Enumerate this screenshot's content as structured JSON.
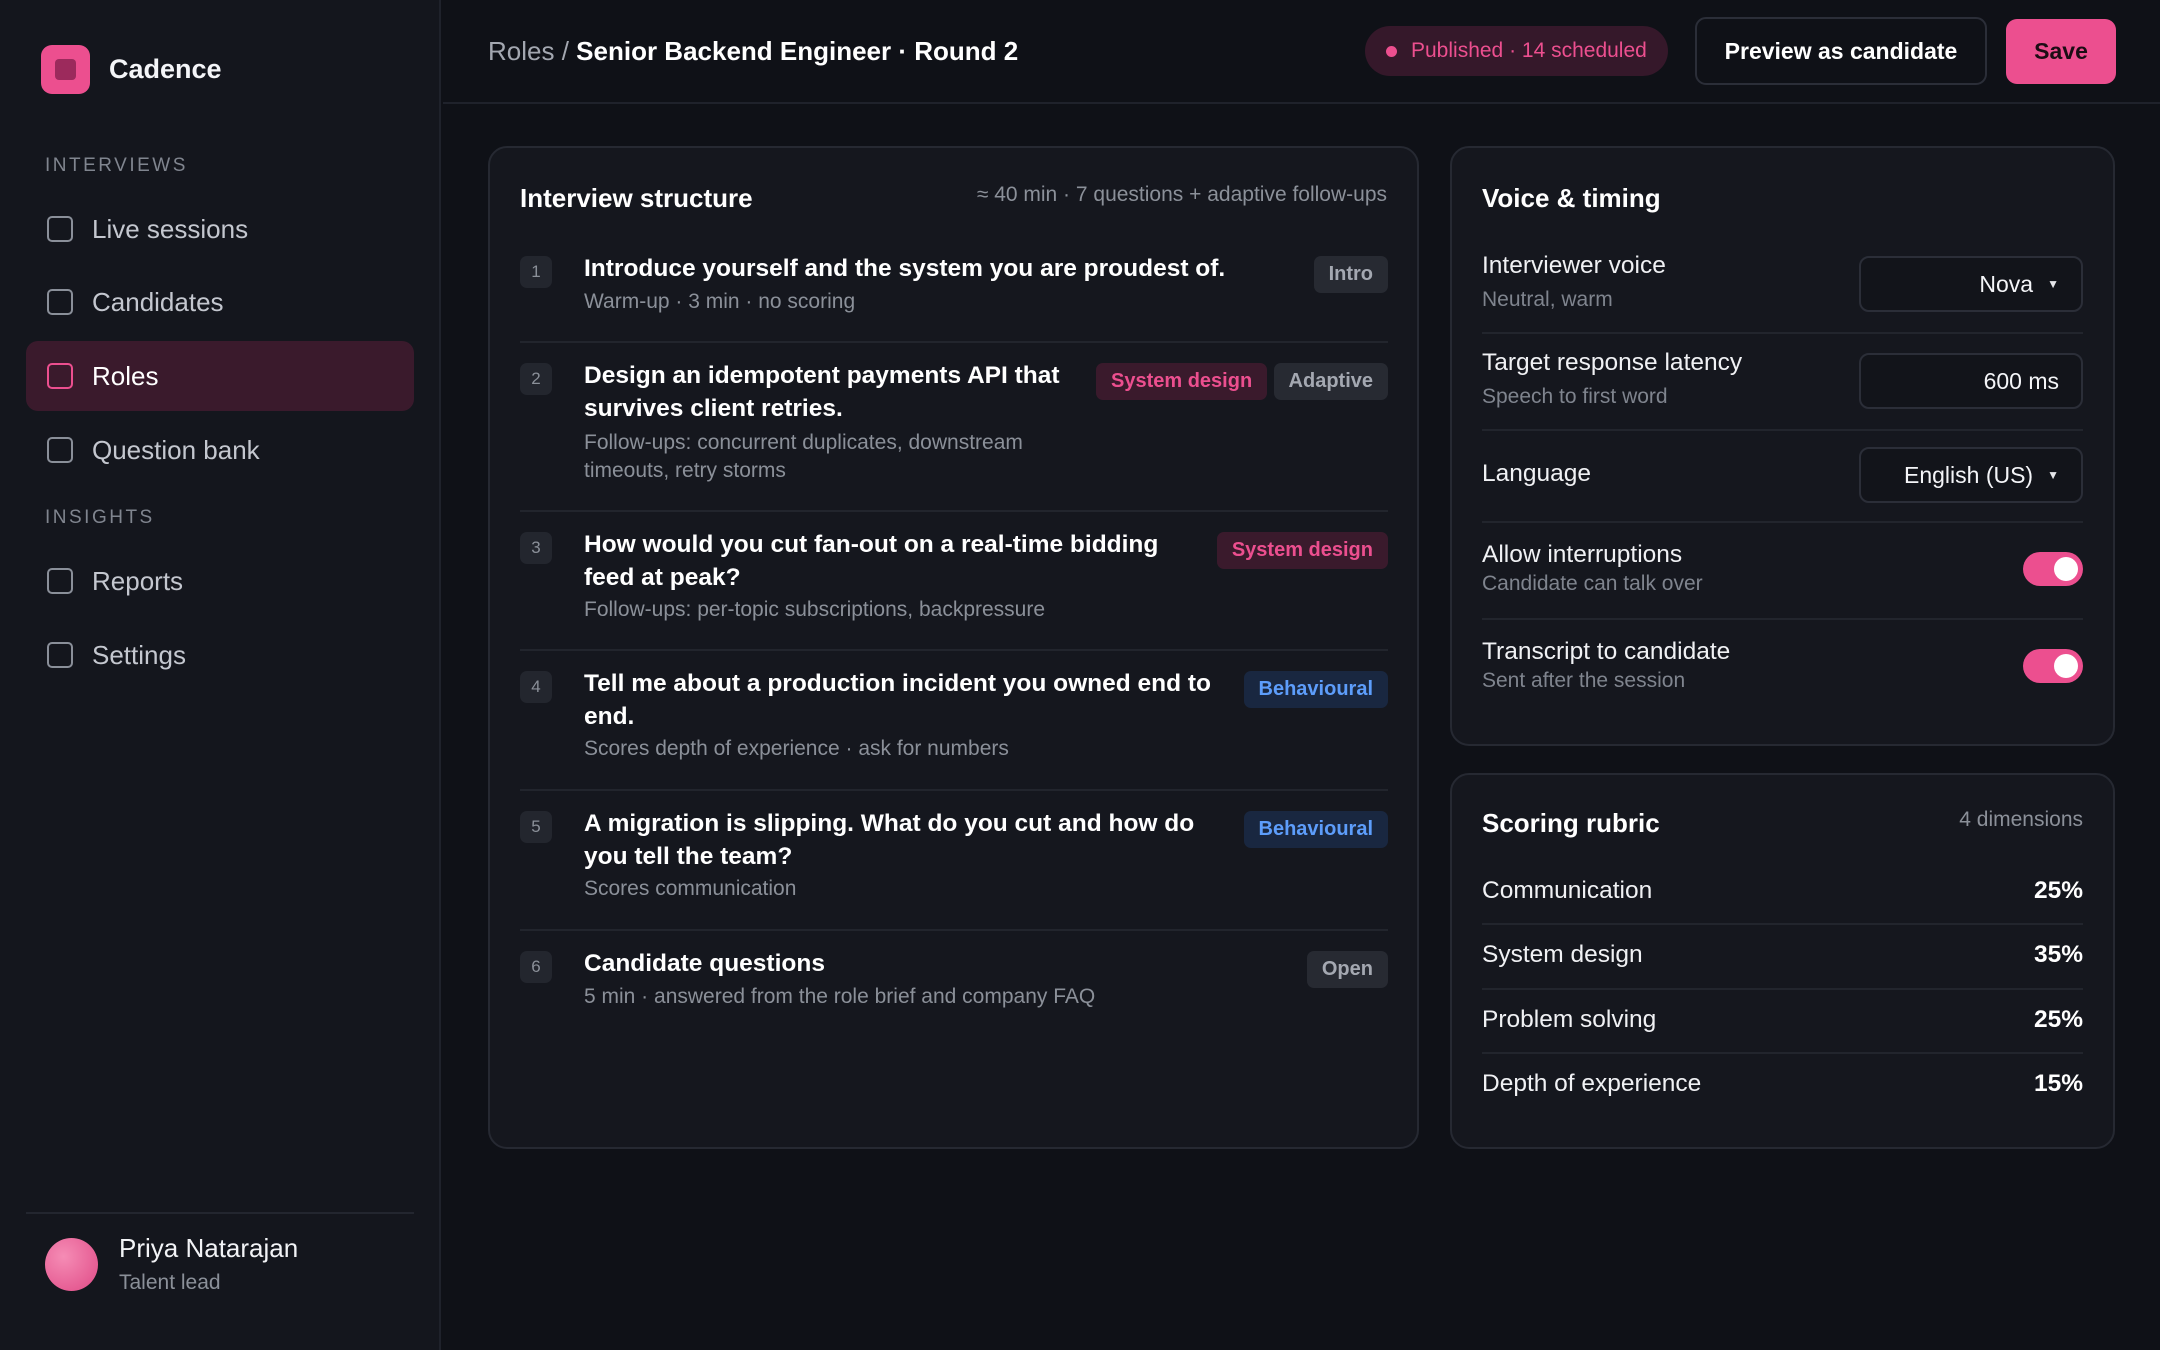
{
  "app": {
    "name": "Cadence"
  },
  "sidebar": {
    "section_interviews": "INTERVIEWS",
    "section_insights": "INSIGHTS",
    "items": [
      {
        "label": "Live sessions"
      },
      {
        "label": "Candidates"
      },
      {
        "label": "Roles",
        "active": true
      },
      {
        "label": "Question bank"
      },
      {
        "label": "Reports"
      },
      {
        "label": "Settings"
      }
    ],
    "user": {
      "name": "Priya Natarajan",
      "role": "Talent lead"
    }
  },
  "header": {
    "breadcrumb_parent": "Roles",
    "breadcrumb_sep": " / ",
    "breadcrumb_current": "Senior Backend Engineer · Round 2",
    "status": "Published · 14 scheduled",
    "preview_label": "Preview as candidate",
    "save_label": "Save"
  },
  "structure": {
    "title": "Interview structure",
    "meta": "≈ 40 min · 7 questions + adaptive follow-ups",
    "questions": [
      {
        "num": "1",
        "title": "Introduce yourself and the system you are proudest of.",
        "sub": "Warm-up · 3 min · no scoring",
        "tags": [
          {
            "label": "Intro",
            "style": "gray"
          }
        ]
      },
      {
        "num": "2",
        "title": "Design an idempotent payments API that survives client retries.",
        "sub": "Follow-ups: concurrent duplicates, downstream timeouts, retry storms",
        "tags": [
          {
            "label": "System design",
            "style": "pink"
          },
          {
            "label": "Adaptive",
            "style": "gray"
          }
        ]
      },
      {
        "num": "3",
        "title": "How would you cut fan-out on a real-time bidding feed at peak?",
        "sub": "Follow-ups: per-topic subscriptions, backpressure",
        "tags": [
          {
            "label": "System design",
            "style": "pink"
          }
        ]
      },
      {
        "num": "4",
        "title": "Tell me about a production incident you owned end to end.",
        "sub": "Scores depth of experience · ask for numbers",
        "tags": [
          {
            "label": "Behavioural",
            "style": "blue"
          }
        ]
      },
      {
        "num": "5",
        "title": "A migration is slipping. What do you cut and how do you tell the team?",
        "sub": "Scores communication",
        "tags": [
          {
            "label": "Behavioural",
            "style": "blue"
          }
        ]
      },
      {
        "num": "6",
        "title": "Candidate questions",
        "sub": "5 min · answered from the role brief and company FAQ",
        "tags": [
          {
            "label": "Open",
            "style": "gray"
          }
        ]
      }
    ]
  },
  "voice": {
    "title": "Voice & timing",
    "settings": [
      {
        "label": "Interviewer voice",
        "sub": "Neutral, warm",
        "value": "Nova",
        "control": "select"
      },
      {
        "label": "Target response latency",
        "sub": "Speech to first word",
        "value": "600 ms",
        "control": "input"
      },
      {
        "label": "Language",
        "sub": "",
        "value": "English (US)",
        "control": "select"
      },
      {
        "label": "Allow interruptions",
        "sub": "Candidate can talk over",
        "value": "on",
        "control": "toggle"
      },
      {
        "label": "Transcript to candidate",
        "sub": "Sent after the session",
        "value": "on",
        "control": "toggle"
      }
    ]
  },
  "rubric": {
    "title": "Scoring rubric",
    "meta": "4 dimensions",
    "items": [
      {
        "label": "Communication",
        "value": "25%"
      },
      {
        "label": "System design",
        "value": "35%"
      },
      {
        "label": "Problem solving",
        "value": "25%"
      },
      {
        "label": "Depth of experience",
        "value": "15%"
      }
    ]
  },
  "colors": {
    "accent": "#ec4f8f",
    "background": "#0f1117",
    "panel": "#15171e",
    "tag_blue": "#5d9dfa"
  }
}
